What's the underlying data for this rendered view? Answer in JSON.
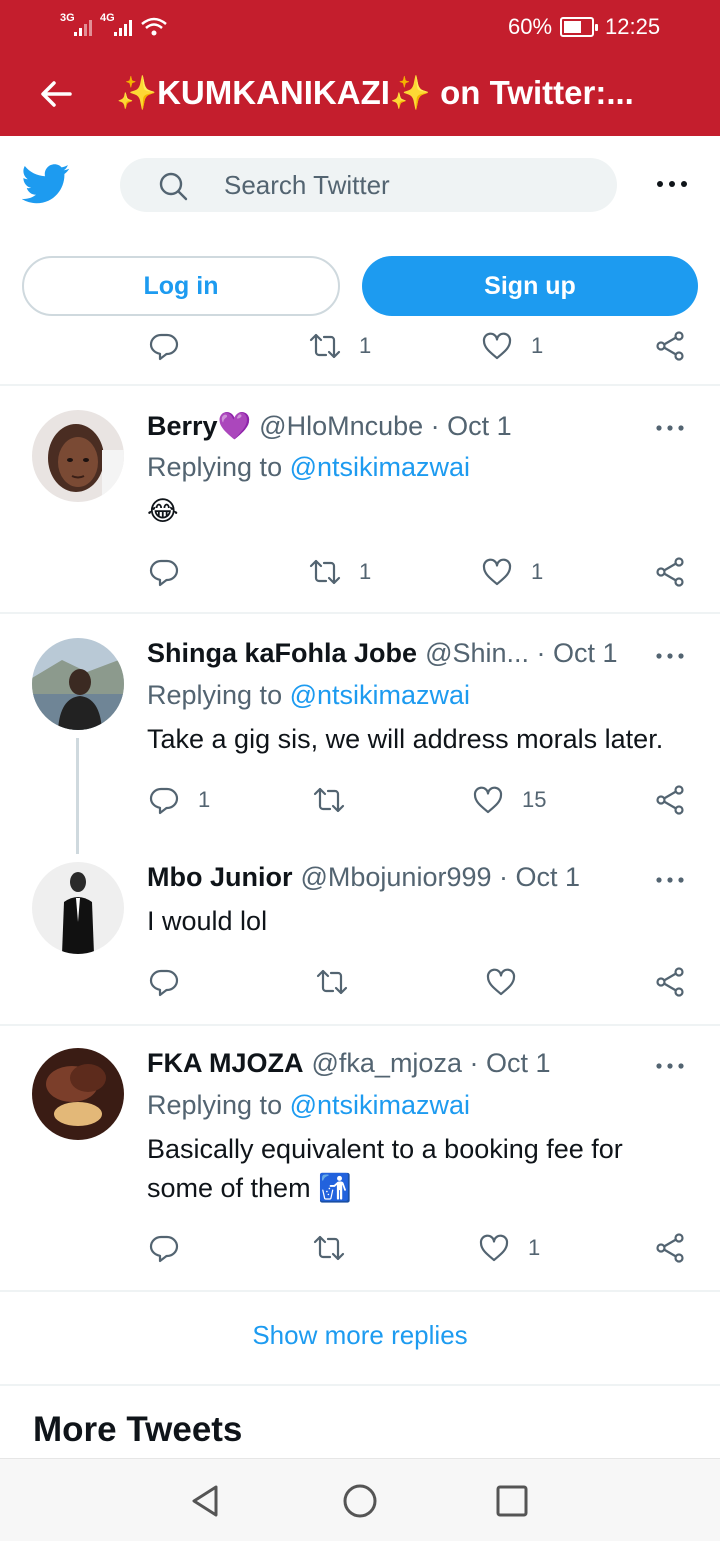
{
  "status_bar": {
    "network1": "3G",
    "network2": "4G",
    "battery": "60%",
    "time": "12:25"
  },
  "app_bar": {
    "title": "✨KUMKANIKAZI✨ on Twitter:..."
  },
  "header": {
    "search_placeholder": "Search Twitter",
    "login_label": "Log in",
    "signup_label": "Sign up"
  },
  "top_actions": {
    "retweets": "1",
    "likes": "1"
  },
  "tweets": [
    {
      "name": "Berry💜",
      "handle": "@HloMncube · Oct 1",
      "replying_prefix": "Replying to ",
      "replying_to": "@ntsikimazwai",
      "text": "😂",
      "replies": "",
      "retweets": "1",
      "likes": "1"
    },
    {
      "name": "Shinga kaFohla Jobe",
      "handle": "@Shin... · Oct 1",
      "replying_prefix": "Replying to ",
      "replying_to": "@ntsikimazwai",
      "text": "Take a gig sis, we will address morals later.",
      "replies": "1",
      "retweets": "",
      "likes": "15"
    },
    {
      "name": "Mbo Junior",
      "handle": "@Mbojunior999 · Oct 1",
      "text": "I would lol",
      "replies": "",
      "retweets": "",
      "likes": ""
    },
    {
      "name": "FKA MJOZA",
      "handle": "@fka_mjoza · Oct 1",
      "replying_prefix": "Replying to ",
      "replying_to": "@ntsikimazwai",
      "text_line1": "Basically equivalent to a booking fee for",
      "text_line2": "some of them 🚮",
      "replies": "",
      "retweets": "",
      "likes": "1"
    }
  ],
  "show_more": "Show more replies",
  "more_tweets": "More Tweets",
  "colors": {
    "app_bar": "#c41e2d",
    "twitter_blue": "#1d9bf0",
    "secondary_text": "#536471"
  },
  "icons": [
    "back-arrow-icon",
    "twitter-bird-icon",
    "search-icon",
    "more-icon",
    "reply-icon",
    "retweet-icon",
    "like-icon",
    "share-icon",
    "nav-back-icon",
    "nav-home-icon",
    "nav-recents-icon"
  ]
}
